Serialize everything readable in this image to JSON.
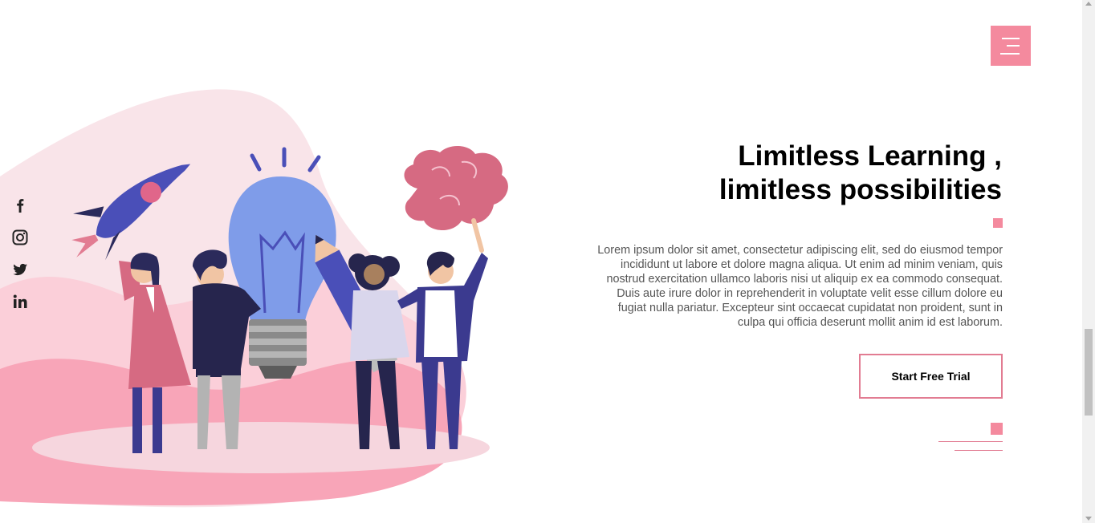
{
  "header": {
    "menu_icon": "hamburger-menu-icon",
    "menu_color": "#f48a9e"
  },
  "social": [
    {
      "name": "facebook",
      "icon": "facebook-icon"
    },
    {
      "name": "instagram",
      "icon": "instagram-icon"
    },
    {
      "name": "twitter",
      "icon": "twitter-icon"
    },
    {
      "name": "linkedin",
      "icon": "linkedin-icon"
    }
  ],
  "hero": {
    "title_line1": "Limitless Learning ,",
    "title_line2": "limitless possibilities",
    "body": "Lorem ipsum dolor sit amet, consectetur adipiscing elit, sed do eiusmod tempor incididunt ut labore et dolore magna aliqua. Ut enim ad minim veniam, quis nostrud exercitation ullamco laboris nisi ut aliquip ex ea commodo consequat. Duis aute irure dolor in reprehenderit in voluptate velit esse cillum dolore eu fugiat nulla pariatur. Excepteur sint occaecat cupidatat non proident, sunt in culpa qui officia deserunt mollit anim id est laborum.",
    "cta_label": "Start Free Trial",
    "illustration": "people-with-lightbulb-rocket-brain-illustration"
  },
  "colors": {
    "accent": "#f48a9e",
    "border": "#e27c92",
    "text": "#000000",
    "muted": "#555555"
  }
}
